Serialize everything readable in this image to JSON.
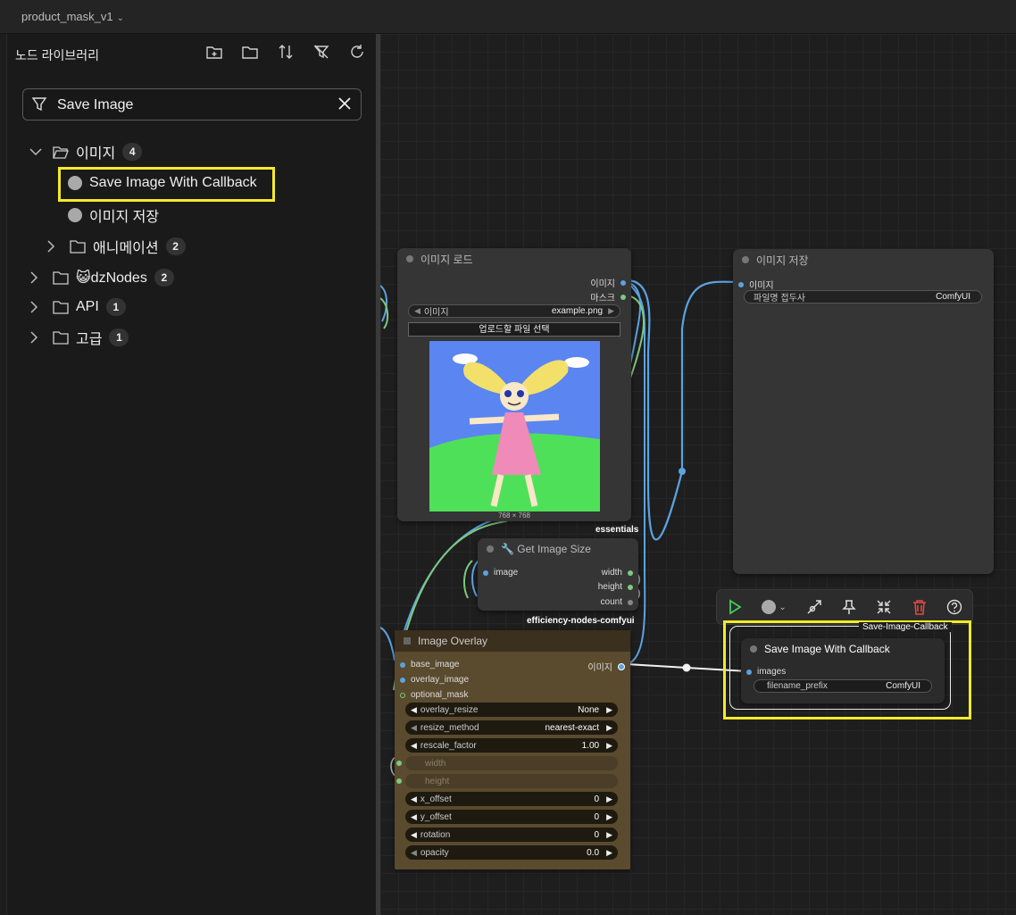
{
  "workflow": {
    "name": "product_mask_v1"
  },
  "sidebar": {
    "title": "노드 라이브러리",
    "search": {
      "value": "Save Image"
    },
    "tree": [
      {
        "label": "이미지",
        "count": "4"
      },
      {
        "label": "Save Image With Callback"
      },
      {
        "label": "이미지 저장"
      },
      {
        "label": "애니메이션",
        "count": "2"
      },
      {
        "label": "😺dzNodes",
        "count": "2"
      },
      {
        "label": "API",
        "count": "1"
      },
      {
        "label": "고급",
        "count": "1"
      }
    ]
  },
  "nodes": {
    "load_image": {
      "title": "이미지 로드",
      "out_image": "이미지",
      "out_mask": "마스크",
      "widget_label": "이미지",
      "widget_value": "example.png",
      "upload_button": "업로드할 파일 선택",
      "dims": "768 × 768",
      "tag": "essentials"
    },
    "save_image": {
      "title": "이미지 저장",
      "in_image": "이미지",
      "prefix_label": "파일명 접두사",
      "prefix_value": "ComfyUI"
    },
    "get_image_size": {
      "title": "🔧 Get Image Size",
      "in_image": "image",
      "out_width": "width",
      "out_height": "height",
      "out_count": "count",
      "tag": "efficiency-nodes-comfyui"
    },
    "image_overlay": {
      "title": "Image Overlay",
      "in_base": "base_image",
      "in_overlay": "overlay_image",
      "in_mask": "optional_mask",
      "out_image": "이미지",
      "widgets": [
        {
          "label": "overlay_resize",
          "value": "None"
        },
        {
          "label": "resize_method",
          "value": "nearest-exact"
        },
        {
          "label": "rescale_factor",
          "value": "1.00"
        },
        {
          "label": "width",
          "value": ""
        },
        {
          "label": "height",
          "value": ""
        },
        {
          "label": "x_offset",
          "value": "0"
        },
        {
          "label": "y_offset",
          "value": "0"
        },
        {
          "label": "rotation",
          "value": "0"
        },
        {
          "label": "opacity",
          "value": "0.0"
        }
      ]
    },
    "save_callback": {
      "group_label": "Save-Image-Callback",
      "title": "Save Image With Callback",
      "in_images": "images",
      "prefix_label": "filename_prefix",
      "prefix_value": "ComfyUI"
    }
  },
  "colors": {
    "highlight": "#f4ea2a",
    "wire_image": "#5ba3e0",
    "wire_mask": "#7ec97e",
    "overlay_body": "#5a4a2e"
  }
}
